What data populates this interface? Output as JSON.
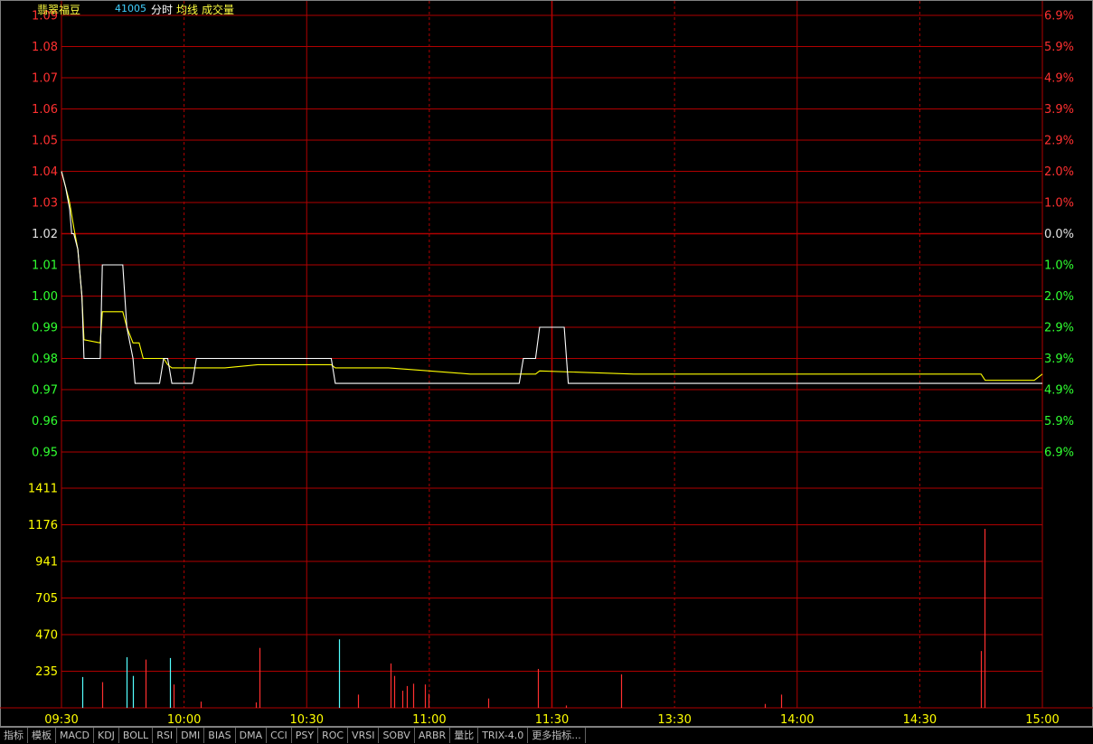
{
  "header": {
    "stock_name": "翡翠福豆",
    "stock_code": "41005",
    "mode_label": "分时",
    "avg_label": "均线",
    "vol_label": "成交量"
  },
  "colors": {
    "price_line": "#ffffff",
    "avg_line": "#ffff00",
    "grid": "#b00000",
    "up": "#ff3030",
    "down": "#30ff30",
    "flat": "#e0e0e0",
    "vol_axis": "#ffff00",
    "vol_up": "#ff3030",
    "vol_down": "#54ffff"
  },
  "tabs": [
    "指标",
    "模板",
    "MACD",
    "KDJ",
    "BOLL",
    "RSI",
    "DMI",
    "BIAS",
    "DMA",
    "CCI",
    "PSY",
    "ROC",
    "VRSI",
    "SOBV",
    "ARBR",
    "量比",
    "TRIX-4.0",
    "更多指标..."
  ],
  "chart_data": {
    "type": "line",
    "prev_close": 1.02,
    "price_ticks": [
      {
        "v": "1.09",
        "pct": "6.9%",
        "d": 1
      },
      {
        "v": "1.08",
        "pct": "5.9%",
        "d": 1
      },
      {
        "v": "1.07",
        "pct": "4.9%",
        "d": 1
      },
      {
        "v": "1.06",
        "pct": "3.9%",
        "d": 1
      },
      {
        "v": "1.05",
        "pct": "2.9%",
        "d": 1
      },
      {
        "v": "1.04",
        "pct": "2.0%",
        "d": 1
      },
      {
        "v": "1.03",
        "pct": "1.0%",
        "d": 1
      },
      {
        "v": "1.02",
        "pct": "0.0%",
        "d": 0
      },
      {
        "v": "1.01",
        "pct": "1.0%",
        "d": -1
      },
      {
        "v": "1.00",
        "pct": "2.0%",
        "d": -1
      },
      {
        "v": "0.99",
        "pct": "2.9%",
        "d": -1
      },
      {
        "v": "0.98",
        "pct": "3.9%",
        "d": -1
      },
      {
        "v": "0.97",
        "pct": "4.9%",
        "d": -1
      },
      {
        "v": "0.96",
        "pct": "5.9%",
        "d": -1
      },
      {
        "v": "0.95",
        "pct": "6.9%",
        "d": -1
      }
    ],
    "price_ylim": [
      0.95,
      1.09
    ],
    "vol_ticks": [
      "1411",
      "1176",
      "941",
      "705",
      "470",
      "235"
    ],
    "vol_ylim": [
      0,
      1411
    ],
    "time_labels": [
      "09:30",
      "10:00",
      "10:30",
      "11:00",
      "11:30",
      "13:30",
      "14:00",
      "14:30",
      "15:00"
    ],
    "x_range_minutes": [
      0,
      240
    ],
    "price_series": [
      [
        0,
        1.04
      ],
      [
        1,
        1.035
      ],
      [
        2,
        1.028
      ],
      [
        2.5,
        1.02
      ],
      [
        3,
        1.02
      ],
      [
        4,
        1.015
      ],
      [
        5,
        1.0
      ],
      [
        5.5,
        0.98
      ],
      [
        9,
        0.98
      ],
      [
        9.5,
        0.98
      ],
      [
        10,
        1.01
      ],
      [
        15,
        1.01
      ],
      [
        16,
        0.99
      ],
      [
        17.5,
        0.98
      ],
      [
        18,
        0.972
      ],
      [
        24,
        0.972
      ],
      [
        25,
        0.98
      ],
      [
        26,
        0.98
      ],
      [
        27,
        0.972
      ],
      [
        32,
        0.972
      ],
      [
        33,
        0.98
      ],
      [
        66,
        0.98
      ],
      [
        67,
        0.972
      ],
      [
        112,
        0.972
      ],
      [
        113,
        0.98
      ],
      [
        116,
        0.98
      ],
      [
        117,
        0.99
      ],
      [
        123,
        0.99
      ],
      [
        124,
        0.972
      ],
      [
        240,
        0.972
      ]
    ],
    "avg_series": [
      [
        0,
        1.04
      ],
      [
        2,
        1.03
      ],
      [
        3,
        1.022
      ],
      [
        4,
        1.015
      ],
      [
        5,
        1.0
      ],
      [
        5.5,
        0.986
      ],
      [
        9.5,
        0.985
      ],
      [
        10,
        0.995
      ],
      [
        15,
        0.995
      ],
      [
        16,
        0.99
      ],
      [
        17.5,
        0.985
      ],
      [
        19,
        0.985
      ],
      [
        20,
        0.98
      ],
      [
        25,
        0.98
      ],
      [
        26,
        0.978
      ],
      [
        27,
        0.977
      ],
      [
        33,
        0.977
      ],
      [
        40,
        0.977
      ],
      [
        48,
        0.978
      ],
      [
        66,
        0.978
      ],
      [
        67,
        0.977
      ],
      [
        80,
        0.977
      ],
      [
        90,
        0.976
      ],
      [
        100,
        0.975
      ],
      [
        112,
        0.975
      ],
      [
        116,
        0.975
      ],
      [
        117,
        0.976
      ],
      [
        140,
        0.975
      ],
      [
        200,
        0.975
      ],
      [
        225,
        0.975
      ],
      [
        226,
        0.973
      ],
      [
        238,
        0.973
      ],
      [
        240,
        0.975
      ]
    ],
    "volume": [
      {
        "t": 5,
        "v": 198,
        "c": "down"
      },
      {
        "t": 10,
        "v": 165,
        "c": "up"
      },
      {
        "t": 16,
        "v": 325,
        "c": "down"
      },
      {
        "t": 17.5,
        "v": 205,
        "c": "down"
      },
      {
        "t": 20.5,
        "v": 310,
        "c": "up"
      },
      {
        "t": 26.5,
        "v": 320,
        "c": "down"
      },
      {
        "t": 27.5,
        "v": 150,
        "c": "up"
      },
      {
        "t": 34,
        "v": 40,
        "c": "up"
      },
      {
        "t": 47.5,
        "v": 35,
        "c": "up"
      },
      {
        "t": 48.5,
        "v": 385,
        "c": "up"
      },
      {
        "t": 68,
        "v": 440,
        "c": "down"
      },
      {
        "t": 72.5,
        "v": 85,
        "c": "up"
      },
      {
        "t": 80.5,
        "v": 285,
        "c": "up"
      },
      {
        "t": 81.5,
        "v": 205,
        "c": "up"
      },
      {
        "t": 83.5,
        "v": 110,
        "c": "up"
      },
      {
        "t": 84.5,
        "v": 140,
        "c": "up"
      },
      {
        "t": 86,
        "v": 155,
        "c": "up"
      },
      {
        "t": 89,
        "v": 150,
        "c": "up"
      },
      {
        "t": 89.8,
        "v": 90,
        "c": "up"
      },
      {
        "t": 104.5,
        "v": 60,
        "c": "up"
      },
      {
        "t": 116.5,
        "v": 250,
        "c": "up"
      },
      {
        "t": 123.5,
        "v": 15,
        "c": "up"
      },
      {
        "t": 137,
        "v": 215,
        "c": "up"
      },
      {
        "t": 172,
        "v": 25,
        "c": "up"
      },
      {
        "t": 176,
        "v": 85,
        "c": "up"
      },
      {
        "t": 225,
        "v": 365,
        "c": "up"
      },
      {
        "t": 225.8,
        "v": 1150,
        "c": "up"
      }
    ]
  }
}
